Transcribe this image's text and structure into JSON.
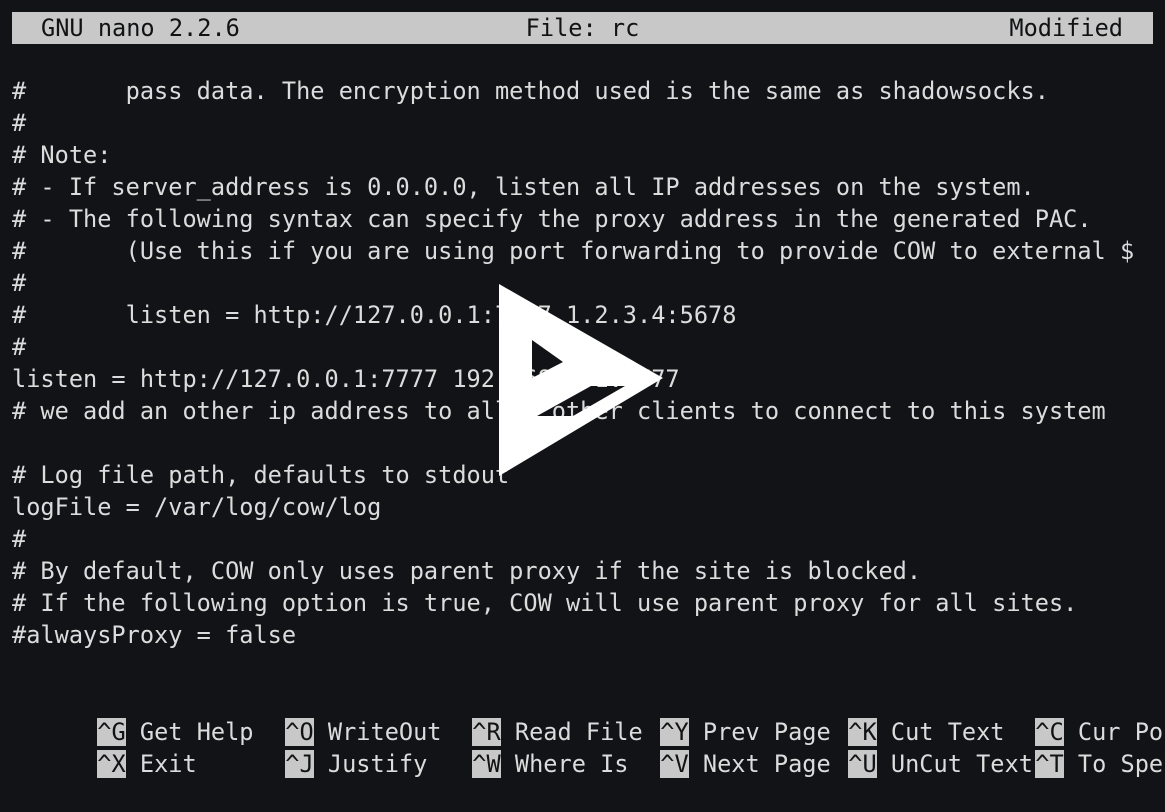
{
  "title_bar": {
    "app": "GNU nano 2.2.6",
    "file": "File: rc",
    "status": "Modified"
  },
  "editor_lines": [
    "#       pass data. The encryption method used is the same as shadowsocks.",
    "#",
    "# Note:",
    "# - If server_address is 0.0.0.0, listen all IP addresses on the system.",
    "# - The following syntax can specify the proxy address in the generated PAC.",
    "#       (Use this if you are using port forwarding to provide COW to external $",
    "#",
    "#       listen = http://127.0.0.1:7777 1.2.3.4:5678",
    "#",
    "listen = http://127.0.0.1:7777 192.168.1.1:7777",
    "# we add an other ip address to allow other clients to connect to this system",
    "",
    "# Log file path, defaults to stdout",
    "logFile = /var/log/cow/log",
    "#",
    "# By default, COW only uses parent proxy if the site is blocked.",
    "# If the following option is true, COW will use parent proxy for all sites.",
    "#alwaysProxy = false"
  ],
  "shortcuts": {
    "row1": [
      {
        "key": "^G",
        "label": "Get Help"
      },
      {
        "key": "^O",
        "label": "WriteOut"
      },
      {
        "key": "^R",
        "label": "Read File"
      },
      {
        "key": "^Y",
        "label": "Prev Page"
      },
      {
        "key": "^K",
        "label": "Cut Text"
      },
      {
        "key": "^C",
        "label": "Cur Pos"
      }
    ],
    "row2": [
      {
        "key": "^X",
        "label": "Exit"
      },
      {
        "key": "^J",
        "label": "Justify"
      },
      {
        "key": "^W",
        "label": "Where Is"
      },
      {
        "key": "^V",
        "label": "Next Page"
      },
      {
        "key": "^U",
        "label": "UnCut Text"
      },
      {
        "key": "^T",
        "label": "To Spell"
      }
    ]
  },
  "overlay": {
    "icon": "play-logo-icon",
    "color": "#ffffff"
  },
  "colors": {
    "background": "#121316",
    "foreground": "#dcdcdc",
    "bar_background": "#c8c8c8",
    "bar_foreground": "#111214"
  }
}
